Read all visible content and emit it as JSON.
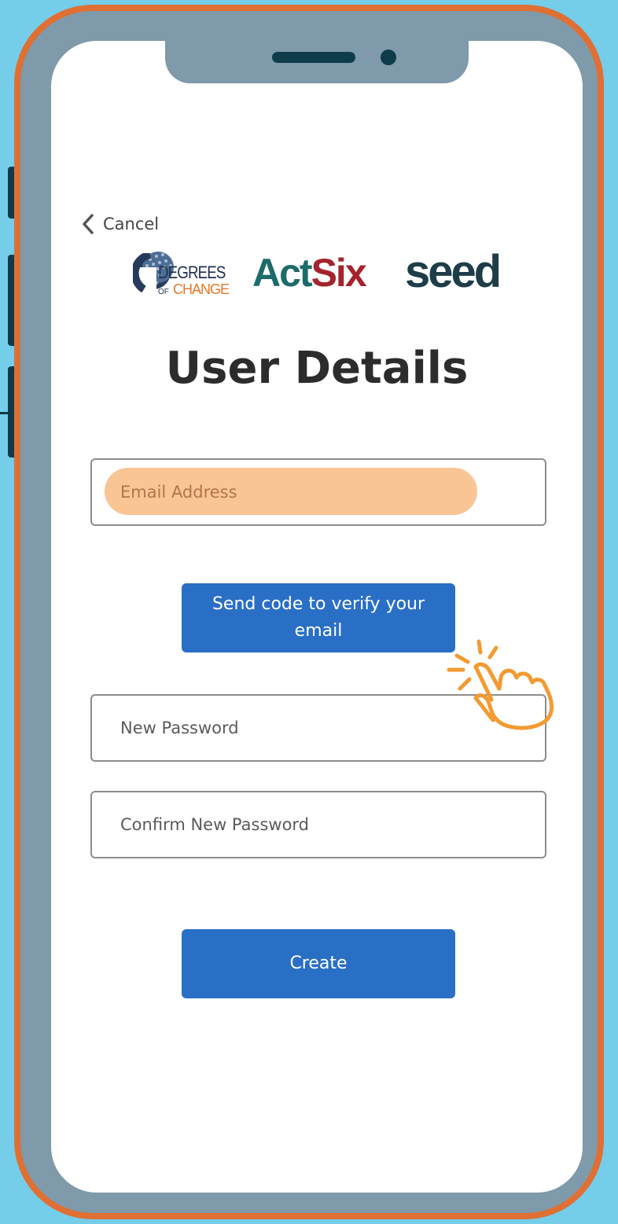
{
  "colors": {
    "background": "#74cde9",
    "phone_frame": "#7f9aaa",
    "phone_outline": "#e06f34",
    "primary_button": "#2a6fc6",
    "email_highlight": "#f9c594"
  },
  "nav": {
    "cancel_label": "Cancel",
    "cancel_icon": "chevron-left-icon"
  },
  "logos": [
    {
      "name": "Degrees of Change",
      "line1": "DEGREES",
      "line2_small": "OF",
      "line2": "CHANGE"
    },
    {
      "name": "ActSix",
      "part1": "Act",
      "part2": "Six"
    },
    {
      "name": "seed",
      "text": "seed"
    }
  ],
  "page": {
    "title": "User Details"
  },
  "form": {
    "email_placeholder": "Email Address",
    "send_code_label": "Send code to verify your email",
    "new_password_placeholder": "New Password",
    "confirm_password_placeholder": "Confirm New Password",
    "create_label": "Create"
  },
  "annotation": {
    "icon": "tap-hand-icon",
    "color": "#f39a32"
  }
}
